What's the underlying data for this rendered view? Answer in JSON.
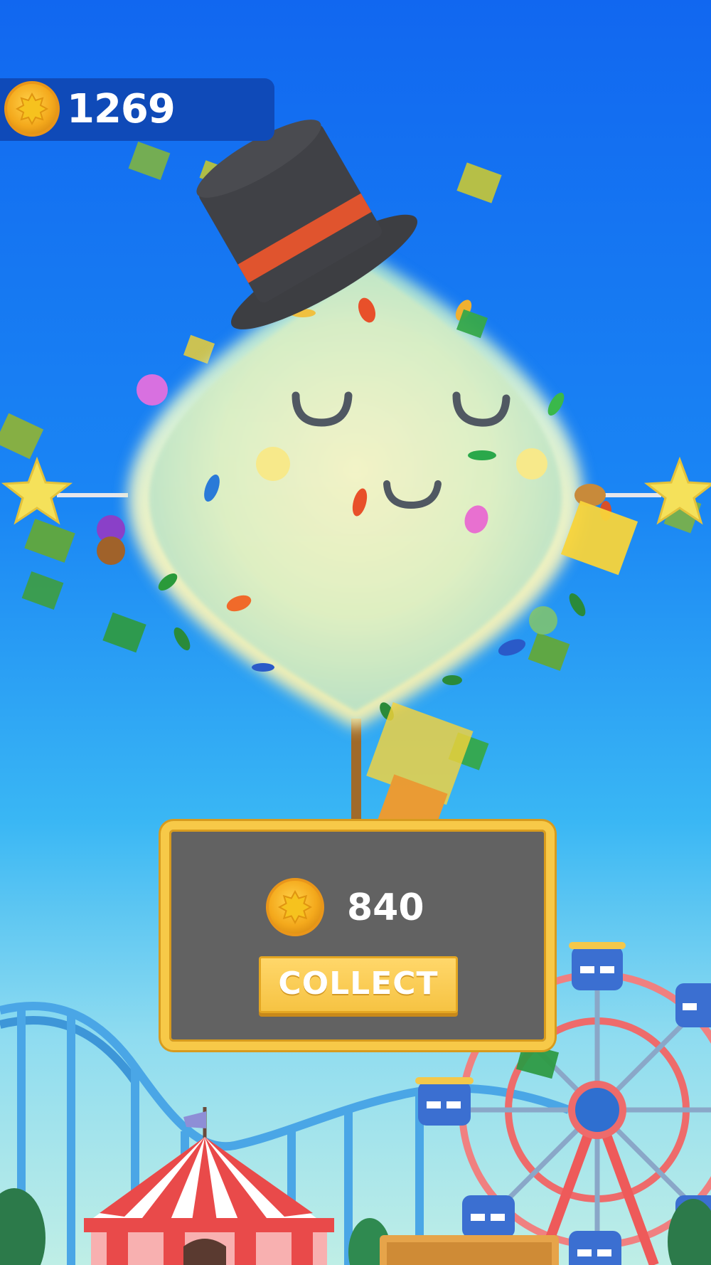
{
  "hud": {
    "coin_balance": "1269",
    "coin_icon": "coin-icon"
  },
  "reward_panel": {
    "coin_icon": "coin-icon",
    "reward_amount": "840",
    "collect_label": "COLLECT"
  },
  "scene": {
    "character": "cotton-candy-with-top-hat",
    "background": "amusement-park"
  },
  "colors": {
    "sky_top": "#1167f0",
    "panel_fill": "#626262",
    "panel_border": "#f7c948",
    "button_fill": "#f6c343",
    "coin_gold": "#f4a91c",
    "hud_bar": "#0f4ab8"
  }
}
